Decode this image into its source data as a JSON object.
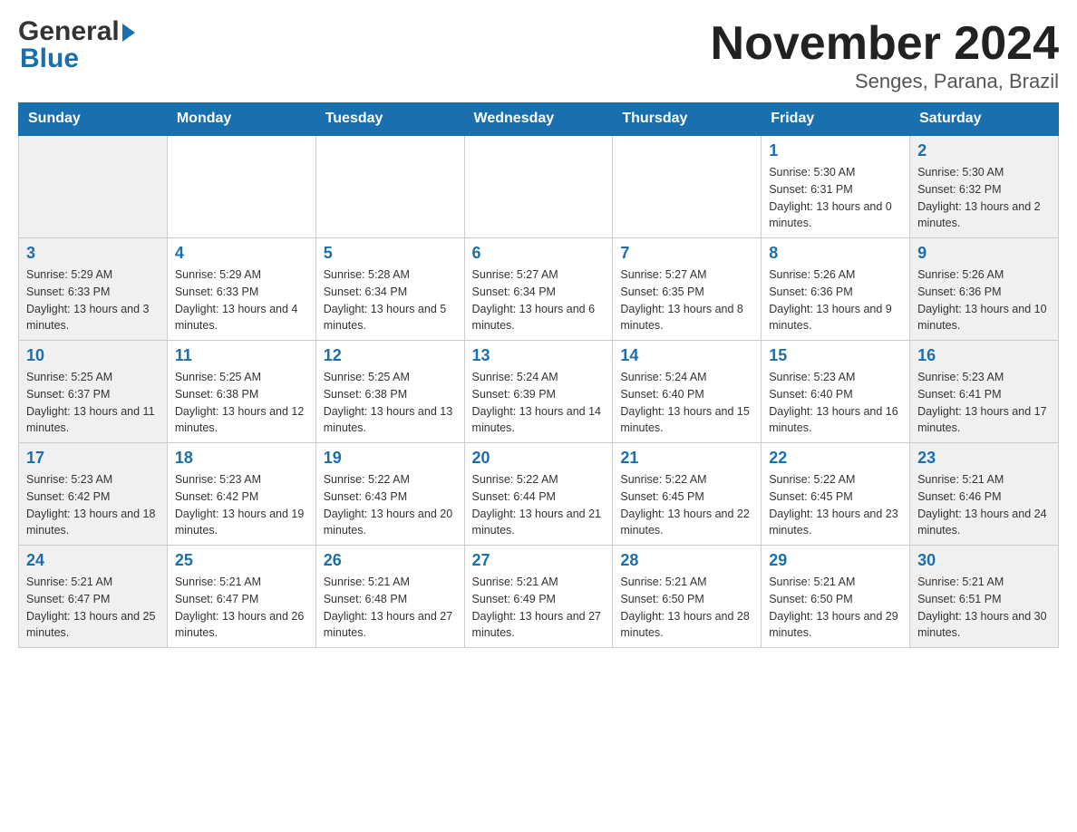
{
  "logo": {
    "general": "General",
    "blue_text": "Blue",
    "arrow": "▶"
  },
  "title": "November 2024",
  "subtitle": "Senges, Parana, Brazil",
  "days_of_week": [
    "Sunday",
    "Monday",
    "Tuesday",
    "Wednesday",
    "Thursday",
    "Friday",
    "Saturday"
  ],
  "weeks": [
    [
      {
        "day": "",
        "sunrise": "",
        "sunset": "",
        "daylight": ""
      },
      {
        "day": "",
        "sunrise": "",
        "sunset": "",
        "daylight": ""
      },
      {
        "day": "",
        "sunrise": "",
        "sunset": "",
        "daylight": ""
      },
      {
        "day": "",
        "sunrise": "",
        "sunset": "",
        "daylight": ""
      },
      {
        "day": "",
        "sunrise": "",
        "sunset": "",
        "daylight": ""
      },
      {
        "day": "1",
        "sunrise": "Sunrise: 5:30 AM",
        "sunset": "Sunset: 6:31 PM",
        "daylight": "Daylight: 13 hours and 0 minutes."
      },
      {
        "day": "2",
        "sunrise": "Sunrise: 5:30 AM",
        "sunset": "Sunset: 6:32 PM",
        "daylight": "Daylight: 13 hours and 2 minutes."
      }
    ],
    [
      {
        "day": "3",
        "sunrise": "Sunrise: 5:29 AM",
        "sunset": "Sunset: 6:33 PM",
        "daylight": "Daylight: 13 hours and 3 minutes."
      },
      {
        "day": "4",
        "sunrise": "Sunrise: 5:29 AM",
        "sunset": "Sunset: 6:33 PM",
        "daylight": "Daylight: 13 hours and 4 minutes."
      },
      {
        "day": "5",
        "sunrise": "Sunrise: 5:28 AM",
        "sunset": "Sunset: 6:34 PM",
        "daylight": "Daylight: 13 hours and 5 minutes."
      },
      {
        "day": "6",
        "sunrise": "Sunrise: 5:27 AM",
        "sunset": "Sunset: 6:34 PM",
        "daylight": "Daylight: 13 hours and 6 minutes."
      },
      {
        "day": "7",
        "sunrise": "Sunrise: 5:27 AM",
        "sunset": "Sunset: 6:35 PM",
        "daylight": "Daylight: 13 hours and 8 minutes."
      },
      {
        "day": "8",
        "sunrise": "Sunrise: 5:26 AM",
        "sunset": "Sunset: 6:36 PM",
        "daylight": "Daylight: 13 hours and 9 minutes."
      },
      {
        "day": "9",
        "sunrise": "Sunrise: 5:26 AM",
        "sunset": "Sunset: 6:36 PM",
        "daylight": "Daylight: 13 hours and 10 minutes."
      }
    ],
    [
      {
        "day": "10",
        "sunrise": "Sunrise: 5:25 AM",
        "sunset": "Sunset: 6:37 PM",
        "daylight": "Daylight: 13 hours and 11 minutes."
      },
      {
        "day": "11",
        "sunrise": "Sunrise: 5:25 AM",
        "sunset": "Sunset: 6:38 PM",
        "daylight": "Daylight: 13 hours and 12 minutes."
      },
      {
        "day": "12",
        "sunrise": "Sunrise: 5:25 AM",
        "sunset": "Sunset: 6:38 PM",
        "daylight": "Daylight: 13 hours and 13 minutes."
      },
      {
        "day": "13",
        "sunrise": "Sunrise: 5:24 AM",
        "sunset": "Sunset: 6:39 PM",
        "daylight": "Daylight: 13 hours and 14 minutes."
      },
      {
        "day": "14",
        "sunrise": "Sunrise: 5:24 AM",
        "sunset": "Sunset: 6:40 PM",
        "daylight": "Daylight: 13 hours and 15 minutes."
      },
      {
        "day": "15",
        "sunrise": "Sunrise: 5:23 AM",
        "sunset": "Sunset: 6:40 PM",
        "daylight": "Daylight: 13 hours and 16 minutes."
      },
      {
        "day": "16",
        "sunrise": "Sunrise: 5:23 AM",
        "sunset": "Sunset: 6:41 PM",
        "daylight": "Daylight: 13 hours and 17 minutes."
      }
    ],
    [
      {
        "day": "17",
        "sunrise": "Sunrise: 5:23 AM",
        "sunset": "Sunset: 6:42 PM",
        "daylight": "Daylight: 13 hours and 18 minutes."
      },
      {
        "day": "18",
        "sunrise": "Sunrise: 5:23 AM",
        "sunset": "Sunset: 6:42 PM",
        "daylight": "Daylight: 13 hours and 19 minutes."
      },
      {
        "day": "19",
        "sunrise": "Sunrise: 5:22 AM",
        "sunset": "Sunset: 6:43 PM",
        "daylight": "Daylight: 13 hours and 20 minutes."
      },
      {
        "day": "20",
        "sunrise": "Sunrise: 5:22 AM",
        "sunset": "Sunset: 6:44 PM",
        "daylight": "Daylight: 13 hours and 21 minutes."
      },
      {
        "day": "21",
        "sunrise": "Sunrise: 5:22 AM",
        "sunset": "Sunset: 6:45 PM",
        "daylight": "Daylight: 13 hours and 22 minutes."
      },
      {
        "day": "22",
        "sunrise": "Sunrise: 5:22 AM",
        "sunset": "Sunset: 6:45 PM",
        "daylight": "Daylight: 13 hours and 23 minutes."
      },
      {
        "day": "23",
        "sunrise": "Sunrise: 5:21 AM",
        "sunset": "Sunset: 6:46 PM",
        "daylight": "Daylight: 13 hours and 24 minutes."
      }
    ],
    [
      {
        "day": "24",
        "sunrise": "Sunrise: 5:21 AM",
        "sunset": "Sunset: 6:47 PM",
        "daylight": "Daylight: 13 hours and 25 minutes."
      },
      {
        "day": "25",
        "sunrise": "Sunrise: 5:21 AM",
        "sunset": "Sunset: 6:47 PM",
        "daylight": "Daylight: 13 hours and 26 minutes."
      },
      {
        "day": "26",
        "sunrise": "Sunrise: 5:21 AM",
        "sunset": "Sunset: 6:48 PM",
        "daylight": "Daylight: 13 hours and 27 minutes."
      },
      {
        "day": "27",
        "sunrise": "Sunrise: 5:21 AM",
        "sunset": "Sunset: 6:49 PM",
        "daylight": "Daylight: 13 hours and 27 minutes."
      },
      {
        "day": "28",
        "sunrise": "Sunrise: 5:21 AM",
        "sunset": "Sunset: 6:50 PM",
        "daylight": "Daylight: 13 hours and 28 minutes."
      },
      {
        "day": "29",
        "sunrise": "Sunrise: 5:21 AM",
        "sunset": "Sunset: 6:50 PM",
        "daylight": "Daylight: 13 hours and 29 minutes."
      },
      {
        "day": "30",
        "sunrise": "Sunrise: 5:21 AM",
        "sunset": "Sunset: 6:51 PM",
        "daylight": "Daylight: 13 hours and 30 minutes."
      }
    ]
  ]
}
